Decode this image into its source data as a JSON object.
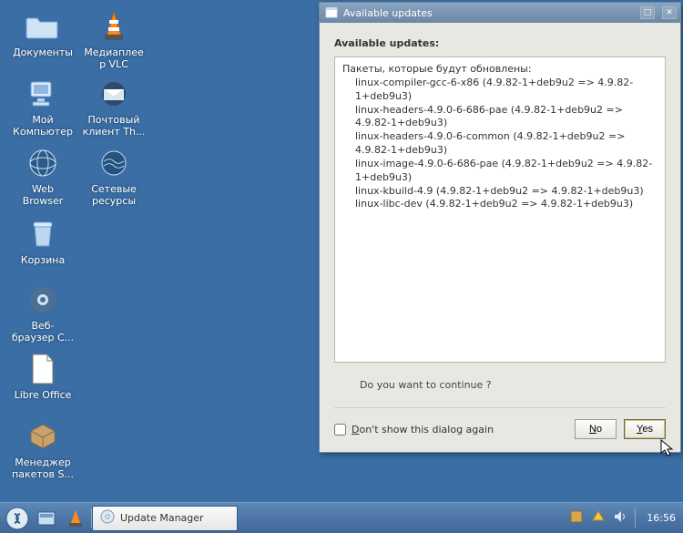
{
  "desktop": {
    "icons": [
      {
        "label": "Документы"
      },
      {
        "label": "Медиаплеер VLC"
      },
      {
        "label": "Мой Компьютер"
      },
      {
        "label": "Почтовый клиент Th..."
      },
      {
        "label": "Web Browser"
      },
      {
        "label": "Сетевые ресурсы"
      },
      {
        "label": "Корзина"
      },
      {
        "label": "Веб-браузер C..."
      },
      {
        "label": "Libre Office"
      },
      {
        "label": "Менеджер пакетов S..."
      }
    ]
  },
  "dialog": {
    "title": "Available updates",
    "heading": "Available updates:",
    "packages_header": "Пакеты, которые будут обновлены:",
    "packages": [
      "linux-compiler-gcc-6-x86 (4.9.82-1+deb9u2 => 4.9.82-1+deb9u3)",
      "linux-headers-4.9.0-6-686-pae (4.9.82-1+deb9u2 => 4.9.82-1+deb9u3)",
      "linux-headers-4.9.0-6-common (4.9.82-1+deb9u2 => 4.9.82-1+deb9u3)",
      "linux-image-4.9.0-6-686-pae (4.9.82-1+deb9u2 => 4.9.82-1+deb9u3)",
      "linux-kbuild-4.9 (4.9.82-1+deb9u2 => 4.9.82-1+deb9u3)",
      "linux-libc-dev (4.9.82-1+deb9u2 => 4.9.82-1+deb9u3)"
    ],
    "question": "Do you want to continue ?",
    "dont_show": "Don't show this dialog again",
    "yes": "Yes",
    "no": "No"
  },
  "taskbar": {
    "app": "Update Manager",
    "clock": "16:56"
  }
}
